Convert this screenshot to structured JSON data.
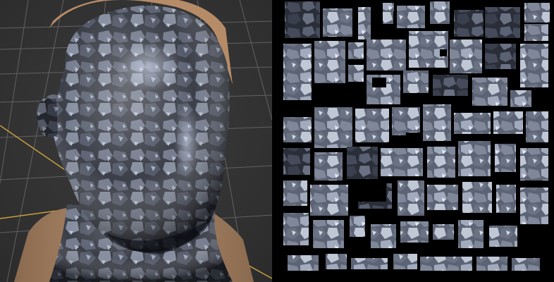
{
  "scene": {
    "left_view": "3d-viewport-rock-textured-head",
    "right_view": "uv-texture-atlas-rock-chunks"
  },
  "colors": {
    "viewport_background": "#353535",
    "grid_line": "#6e6e6e",
    "axis_line": "#c8a040",
    "skin": "#b08a6a",
    "rock_dark": "#2c2f38",
    "rock_light": "#9aa8be",
    "uv_background": "#000000"
  },
  "icons": {
    "head_model": "head-model-icon",
    "uv_atlas": "uv-atlas-icon"
  }
}
